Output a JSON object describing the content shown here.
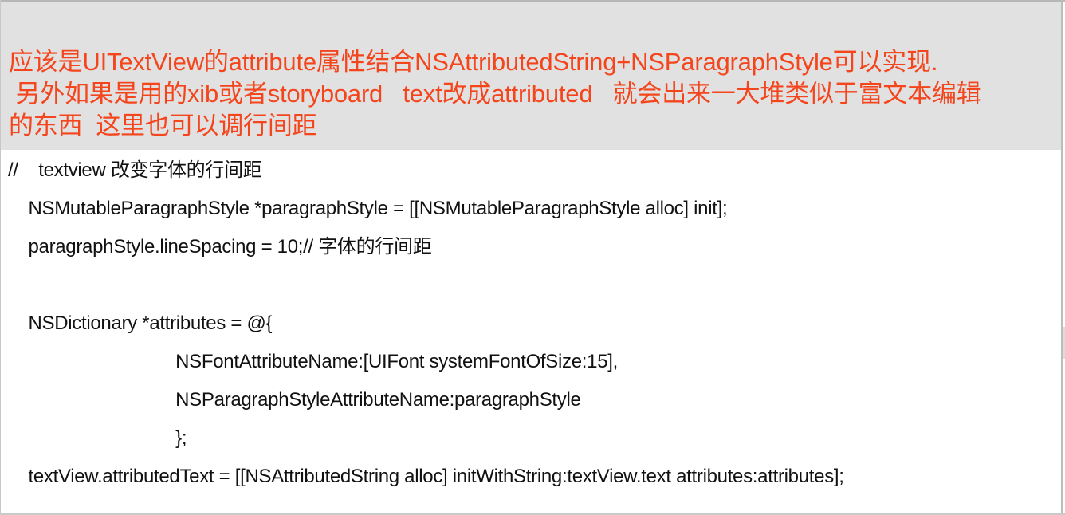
{
  "note": {
    "lines": [
      "应该是UITextView的attribute属性结合NSAttributedString+NSParagraphStyle可以实现.",
      " 另外如果是用的xib或者storyboard   text改成attributed   就会出来一大堆类似于富文本编辑",
      "的东西  这里也可以调行间距"
    ],
    "text_color": "#f4451d",
    "background_color": "#e1e1e1"
  },
  "code": {
    "lines": [
      "//    textview 改变字体的行间距",
      "    NSMutableParagraphStyle *paragraphStyle = [[NSMutableParagraphStyle alloc] init];",
      "    paragraphStyle.lineSpacing = 10;// 字体的行间距",
      "",
      "    NSDictionary *attributes = @{",
      "                                 NSFontAttributeName:[UIFont systemFontOfSize:15],",
      "                                 NSParagraphStyleAttributeName:paragraphStyle",
      "                                 };",
      "    textView.attributedText = [[NSAttributedString alloc] initWithString:textView.text attributes:attributes];"
    ]
  }
}
